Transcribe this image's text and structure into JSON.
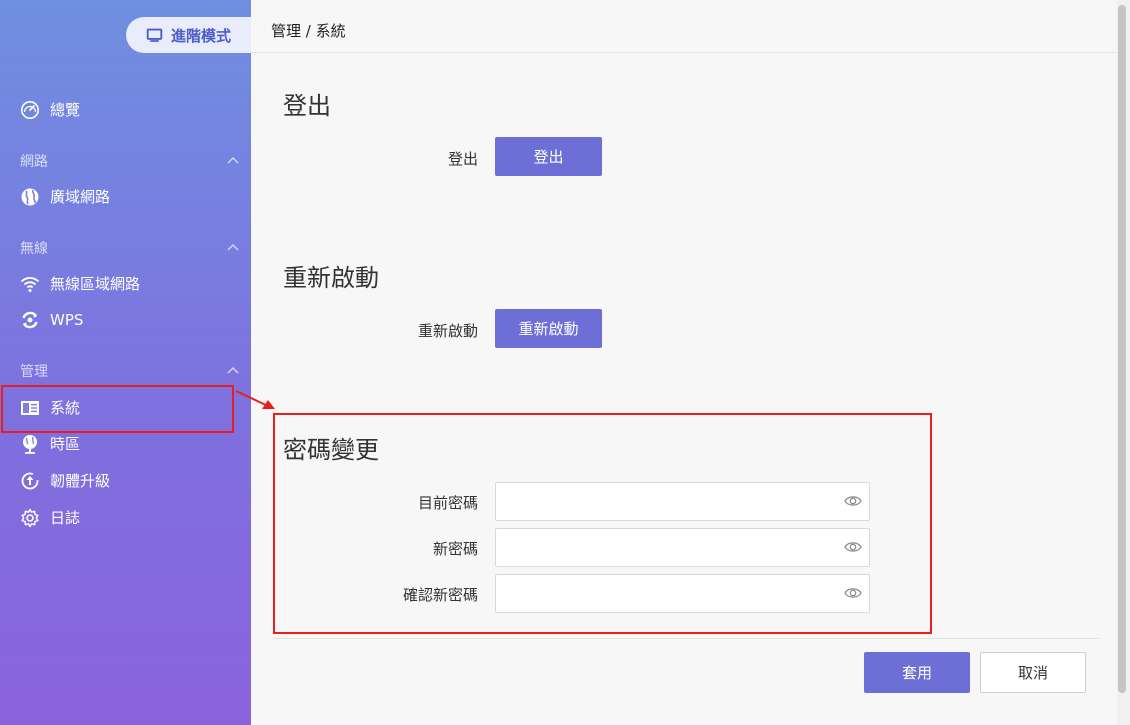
{
  "sidebar": {
    "mode_button": "進階模式",
    "overview": "總覽",
    "sections": {
      "network": {
        "title": "網路",
        "items": [
          "廣域網路"
        ]
      },
      "wireless": {
        "title": "無線",
        "items": [
          "無線區域網路",
          "WPS"
        ]
      },
      "management": {
        "title": "管理",
        "items": [
          "系統",
          "時區",
          "韌體升級",
          "日誌"
        ]
      }
    },
    "active_item": "系統",
    "accent_color": "#6d6fd6"
  },
  "breadcrumb": "管理 / 系統",
  "logout": {
    "title": "登出",
    "label": "登出",
    "button": "登出"
  },
  "reboot": {
    "title": "重新啟動",
    "label": "重新啟動",
    "button": "重新啟動"
  },
  "password_change": {
    "title": "密碼變更",
    "fields": [
      {
        "label": "目前密碼",
        "value": ""
      },
      {
        "label": "新密碼",
        "value": ""
      },
      {
        "label": "確認新密碼",
        "value": ""
      }
    ]
  },
  "footer": {
    "apply": "套用",
    "cancel": "取消"
  }
}
